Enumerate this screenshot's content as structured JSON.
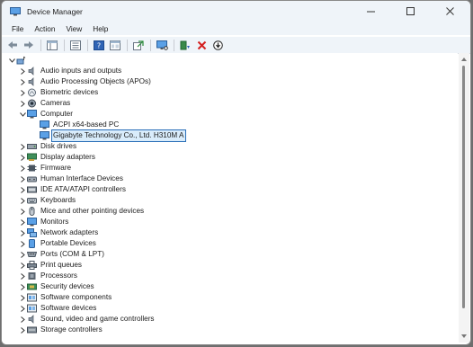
{
  "window": {
    "title": "Device Manager",
    "minimize": "—",
    "maximize": "☐",
    "close": "✕"
  },
  "menu": [
    "File",
    "Action",
    "View",
    "Help"
  ],
  "tree": {
    "root_label": "",
    "items": [
      {
        "label": "Audio inputs and outputs",
        "icon": "speaker-icon",
        "level": 1,
        "expanded": false
      },
      {
        "label": "Audio Processing Objects (APOs)",
        "icon": "speaker-icon",
        "level": 1,
        "expanded": false
      },
      {
        "label": "Biometric devices",
        "icon": "fingerprint-icon",
        "level": 1,
        "expanded": false
      },
      {
        "label": "Cameras",
        "icon": "camera-icon",
        "level": 1,
        "expanded": false
      },
      {
        "label": "Computer",
        "icon": "monitor-icon",
        "level": 1,
        "expanded": true
      },
      {
        "label": "ACPI x64-based PC",
        "icon": "monitor-icon",
        "level": 2
      },
      {
        "label": "Gigabyte Technology Co., Ltd. H310M A",
        "icon": "monitor-icon",
        "level": 2,
        "selected": true
      },
      {
        "label": "Disk drives",
        "icon": "disk-icon",
        "level": 1,
        "expanded": false
      },
      {
        "label": "Display adapters",
        "icon": "display-adapter-icon",
        "level": 1,
        "expanded": false
      },
      {
        "label": "Firmware",
        "icon": "chip-icon",
        "level": 1,
        "expanded": false
      },
      {
        "label": "Human Interface Devices",
        "icon": "hid-icon",
        "level": 1,
        "expanded": false
      },
      {
        "label": "IDE ATA/ATAPI controllers",
        "icon": "controller-icon",
        "level": 1,
        "expanded": false
      },
      {
        "label": "Keyboards",
        "icon": "keyboard-icon",
        "level": 1,
        "expanded": false
      },
      {
        "label": "Mice and other pointing devices",
        "icon": "mouse-icon",
        "level": 1,
        "expanded": false
      },
      {
        "label": "Monitors",
        "icon": "monitor-icon",
        "level": 1,
        "expanded": false
      },
      {
        "label": "Network adapters",
        "icon": "network-icon",
        "level": 1,
        "expanded": false
      },
      {
        "label": "Portable Devices",
        "icon": "portable-device-icon",
        "level": 1,
        "expanded": false
      },
      {
        "label": "Ports (COM & LPT)",
        "icon": "port-icon",
        "level": 1,
        "expanded": false
      },
      {
        "label": "Print queues",
        "icon": "printer-icon",
        "level": 1,
        "expanded": false
      },
      {
        "label": "Processors",
        "icon": "cpu-icon",
        "level": 1,
        "expanded": false
      },
      {
        "label": "Security devices",
        "icon": "security-icon",
        "level": 1,
        "expanded": false
      },
      {
        "label": "Software components",
        "icon": "software-icon",
        "level": 1,
        "expanded": false
      },
      {
        "label": "Software devices",
        "icon": "software-icon",
        "level": 1,
        "expanded": false
      },
      {
        "label": "Sound, video and game controllers",
        "icon": "speaker-icon",
        "level": 1,
        "expanded": false
      },
      {
        "label": "Storage controllers",
        "icon": "storage-icon",
        "level": 1,
        "expanded": false
      }
    ]
  },
  "colors": {
    "titlebar_bg": "#eff4f9",
    "selection_bg": "#d9ecfb",
    "selection_border": "#2a6fb8",
    "accent": "#3c7fd0"
  }
}
